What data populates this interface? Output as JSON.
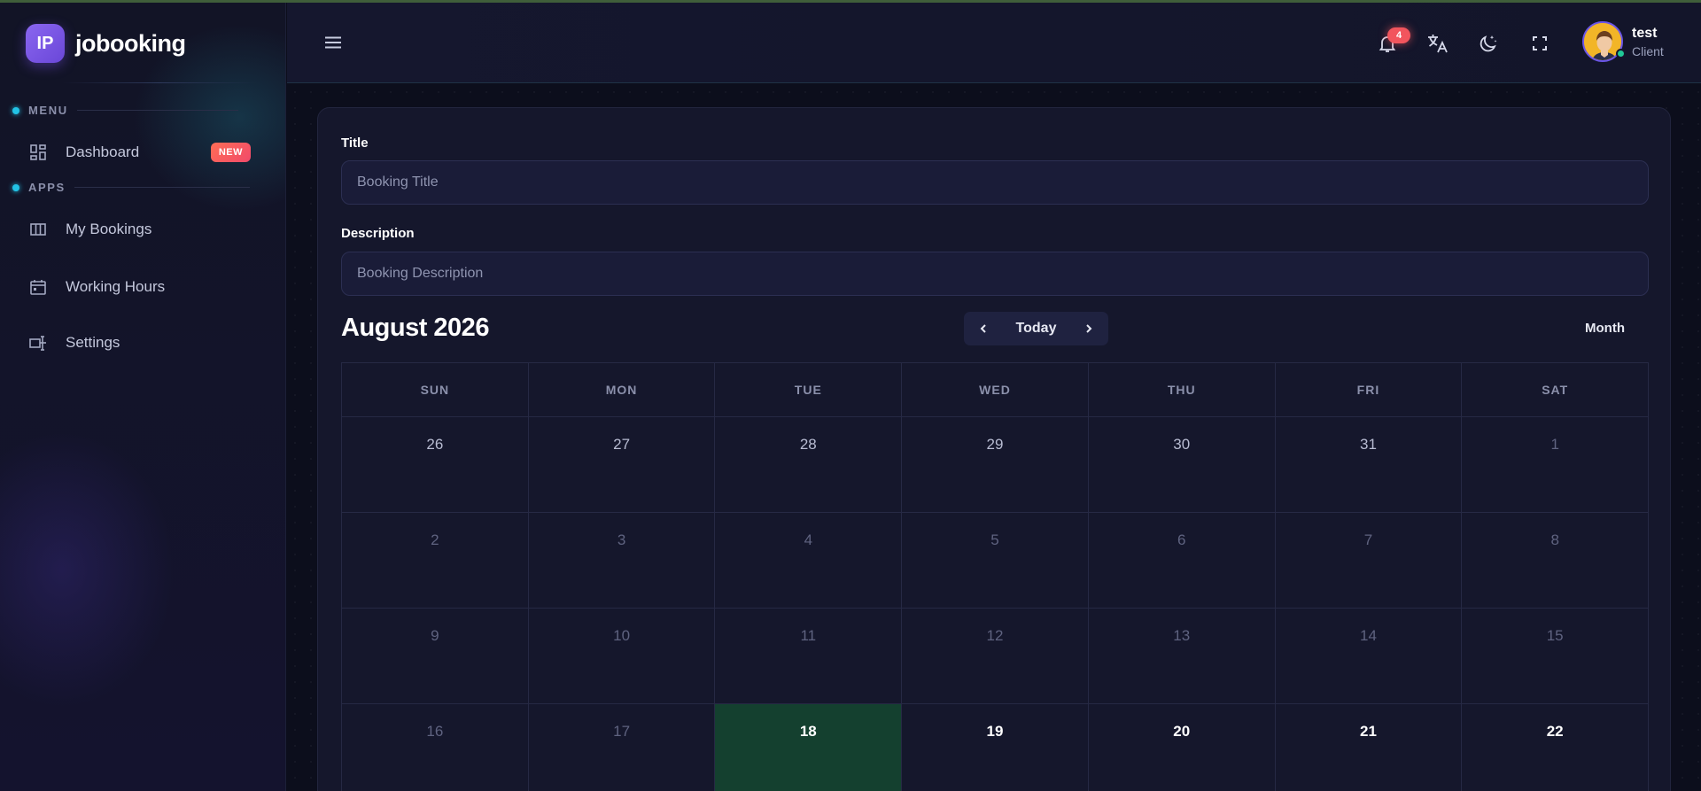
{
  "brand": {
    "logo_text": "IP",
    "name": "jobooking"
  },
  "sidebar": {
    "sections": [
      {
        "label": "MENU"
      },
      {
        "label": "APPS"
      }
    ],
    "items": [
      {
        "label": "Dashboard",
        "icon": "dashboard-icon",
        "badge": "NEW"
      },
      {
        "label": "My Bookings",
        "icon": "columns-icon"
      },
      {
        "label": "Working Hours",
        "icon": "calendar-icon"
      },
      {
        "label": "Settings",
        "icon": "settings-icon"
      }
    ]
  },
  "header": {
    "notification_count": "4",
    "user": {
      "name": "test",
      "role": "Client"
    }
  },
  "form": {
    "title_label": "Title",
    "title_placeholder": "Booking Title",
    "title_value": "",
    "description_label": "Description",
    "description_placeholder": "Booking Description",
    "description_value": ""
  },
  "calendar": {
    "month_title": "August 2026",
    "today_label": "Today",
    "view_label": "Month",
    "weekdays": [
      "SUN",
      "MON",
      "TUE",
      "WED",
      "THU",
      "FRI",
      "SAT"
    ],
    "weeks": [
      [
        "26",
        "27",
        "28",
        "29",
        "30",
        "31",
        "1"
      ],
      [
        "2",
        "3",
        "4",
        "5",
        "6",
        "7",
        "8"
      ],
      [
        "9",
        "10",
        "11",
        "12",
        "13",
        "14",
        "15"
      ],
      [
        "16",
        "17",
        "18",
        "19",
        "20",
        "21",
        "22"
      ]
    ]
  },
  "colors": {
    "accent": "#6a47d8",
    "today_bg": "#14402f",
    "badge_new": "#f14a6a",
    "online": "#20c997"
  }
}
